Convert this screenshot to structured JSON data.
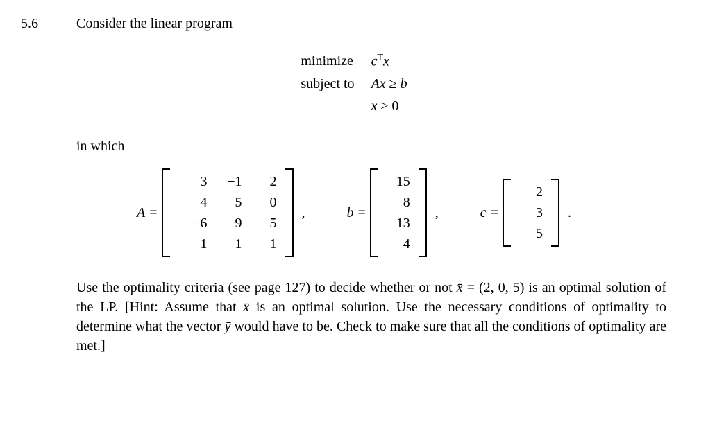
{
  "problem": {
    "number": "5.6",
    "intro": "Consider the linear program",
    "lp": {
      "minimize_label": "minimize",
      "minimize_expr_c": "c",
      "minimize_expr_T": "T",
      "minimize_expr_x": "x",
      "subjectto_label": "subject to",
      "constraint1_A": "A",
      "constraint1_x": "x",
      "constraint1_rel": " ≥ ",
      "constraint1_b": "b",
      "constraint2_x": "x",
      "constraint2_rest": " ≥ 0"
    },
    "in_which": "in which",
    "matrices": {
      "A_label": "A",
      "A": [
        [
          "3",
          "−1",
          "2"
        ],
        [
          "4",
          "5",
          "0"
        ],
        [
          "−6",
          "9",
          "5"
        ],
        [
          "1",
          "1",
          "1"
        ]
      ],
      "b_label": "b",
      "b": [
        [
          "15"
        ],
        [
          "8"
        ],
        [
          "13"
        ],
        [
          "4"
        ]
      ],
      "c_label": "c",
      "c": [
        [
          "2"
        ],
        [
          "3"
        ],
        [
          "5"
        ]
      ],
      "eq": " = ",
      "comma": ",",
      "period": "."
    },
    "body": {
      "part1": "Use the optimality criteria (see page 127) to decide whether or not ",
      "xbar": "x̄",
      "part2": " = (2, 0, 5) is an optimal solution of the LP.  [Hint: Assume that ",
      "part3": " is an optimal solution. Use the necessary conditions of optimality to determine what the vector ",
      "ybar": "ȳ",
      "part4": " would have to be.  Check to make sure that all the conditions of optimality are met.]"
    }
  }
}
